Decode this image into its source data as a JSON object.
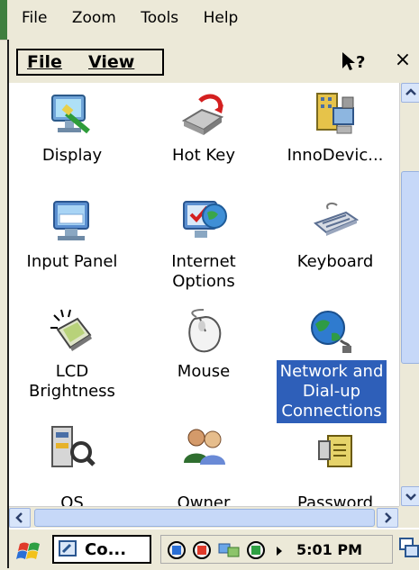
{
  "host": {
    "menu": [
      "File",
      "Zoom",
      "Tools",
      "Help"
    ]
  },
  "window": {
    "menu": {
      "file": "File",
      "view": "View"
    },
    "help_icon": "help-arrow-icon",
    "close_label": "×"
  },
  "items": [
    {
      "label_lines": [
        "Display"
      ],
      "icon": "display-icon"
    },
    {
      "label_lines": [
        "Hot Key"
      ],
      "icon": "hot-key-icon"
    },
    {
      "label_lines": [
        "InnoDevic..."
      ],
      "icon": "innodevice-icon"
    },
    {
      "label_lines": [
        "Input Panel"
      ],
      "icon": "input-panel-icon"
    },
    {
      "label_lines": [
        "Internet",
        "Options"
      ],
      "icon": "internet-options-icon"
    },
    {
      "label_lines": [
        "Keyboard"
      ],
      "icon": "keyboard-icon"
    },
    {
      "label_lines": [
        "LCD",
        "Brightness"
      ],
      "icon": "lcd-brightness-icon"
    },
    {
      "label_lines": [
        "Mouse"
      ],
      "icon": "mouse-icon"
    },
    {
      "label_lines": [
        "Network and",
        "Dial-up",
        "Connections"
      ],
      "icon": "network-icon",
      "selected": true
    },
    {
      "label_lines": [
        "OS"
      ],
      "icon": "os-icon"
    },
    {
      "label_lines": [
        "Owner"
      ],
      "icon": "owner-icon"
    },
    {
      "label_lines": [
        "Password"
      ],
      "icon": "password-icon"
    }
  ],
  "taskbar": {
    "task_label": "Co...",
    "time": "5:01 PM"
  },
  "colors": {
    "selection": "#2e5fb9",
    "chrome": "#ece9d8"
  }
}
